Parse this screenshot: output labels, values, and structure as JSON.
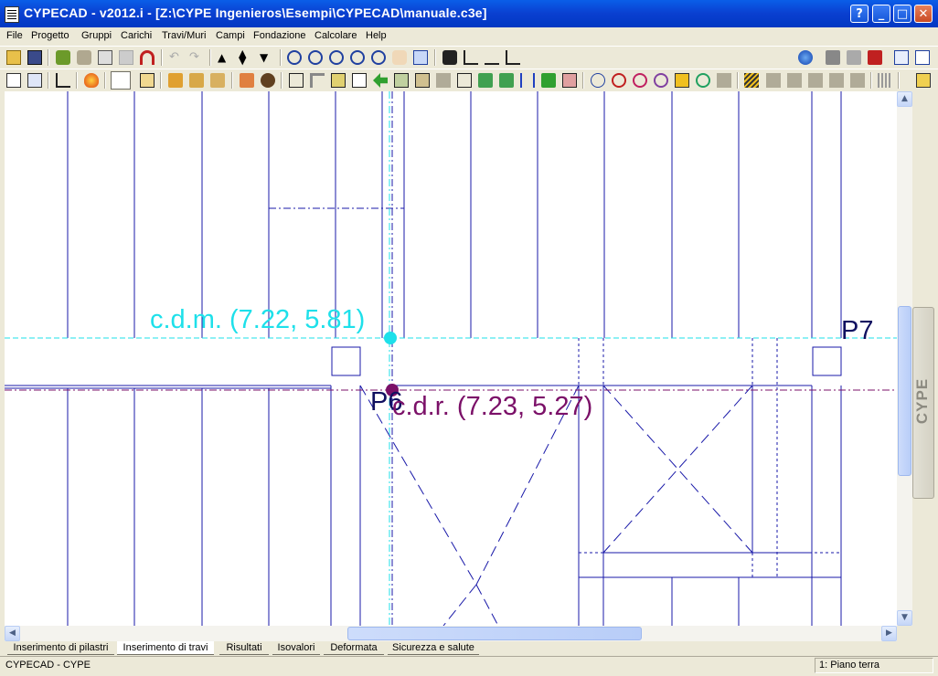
{
  "window": {
    "title": "CYPECAD - v2012.i - [Z:\\CYPE Ingenieros\\Esempi\\CYPECAD\\manuale.c3e]",
    "controls": {
      "help": "?",
      "minimize": "_",
      "maximize": "□",
      "close": "✕"
    }
  },
  "menu": [
    "File",
    "Progetto",
    "Gruppi",
    "Carichi",
    "Travi/Muri",
    "Campi",
    "Fondazione",
    "Calcolare",
    "Help"
  ],
  "drawing": {
    "cdm_label": "c.d.m. (7.22, 5.81)",
    "cdr_label": "c.d.r. (7.23, 5.27)",
    "column_p7": "P7",
    "column_p6": "P6",
    "colors": {
      "cdm": "#1ee0ea",
      "cdr": "#7b1068",
      "lines": "#1818a8",
      "labels": "#101060"
    }
  },
  "side_tab": "CYPE",
  "tabs": [
    "Inserimento di pilastri",
    "Inserimento di travi",
    "Risultati",
    "Isovalori",
    "Deformata",
    "Sicurezza e salute"
  ],
  "active_tab": "Inserimento di travi",
  "status": {
    "left": "CYPECAD - CYPE",
    "right": "1: Piano terra"
  }
}
